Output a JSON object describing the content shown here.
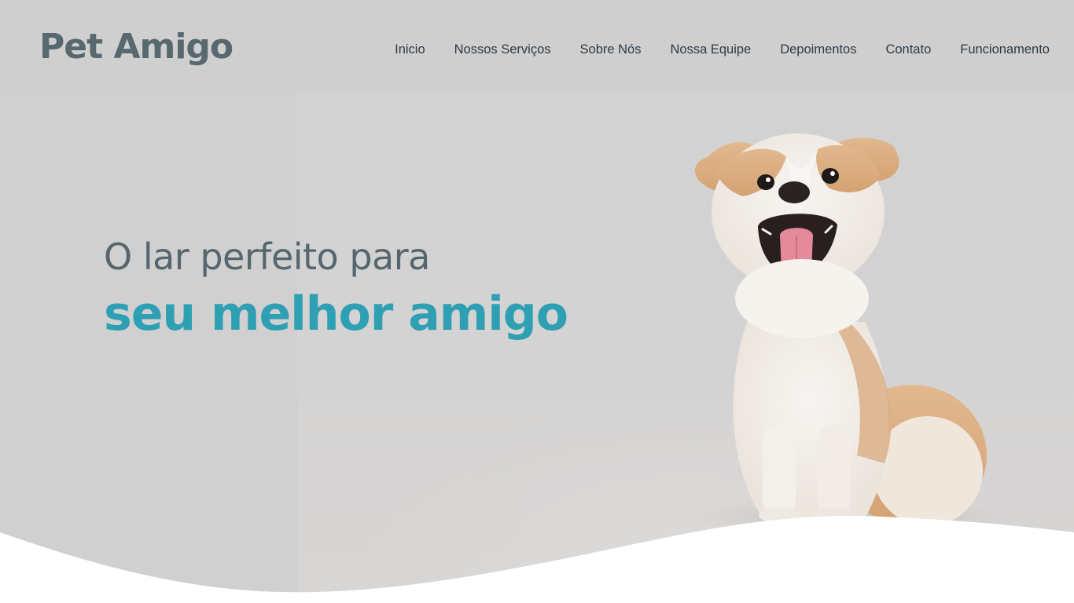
{
  "brand": {
    "logo_text": "Pet Amigo"
  },
  "nav": {
    "items": [
      {
        "label": "Inicio"
      },
      {
        "label": "Nossos Serviços"
      },
      {
        "label": "Sobre Nós"
      },
      {
        "label": "Nossa Equipe"
      },
      {
        "label": "Depoimentos"
      },
      {
        "label": "Contato"
      },
      {
        "label": "Funcionamento"
      }
    ]
  },
  "hero": {
    "line1": "O lar perfeito para",
    "line2": "seu melhor amigo",
    "image_icon": "puppy-photo"
  },
  "colors": {
    "logo": "#57686f",
    "nav_text": "#2c3a44",
    "headline_muted": "#56666e",
    "accent": "#2fa0b4",
    "hero_bg": "#d0d0d1",
    "wave": "#ffffff"
  }
}
